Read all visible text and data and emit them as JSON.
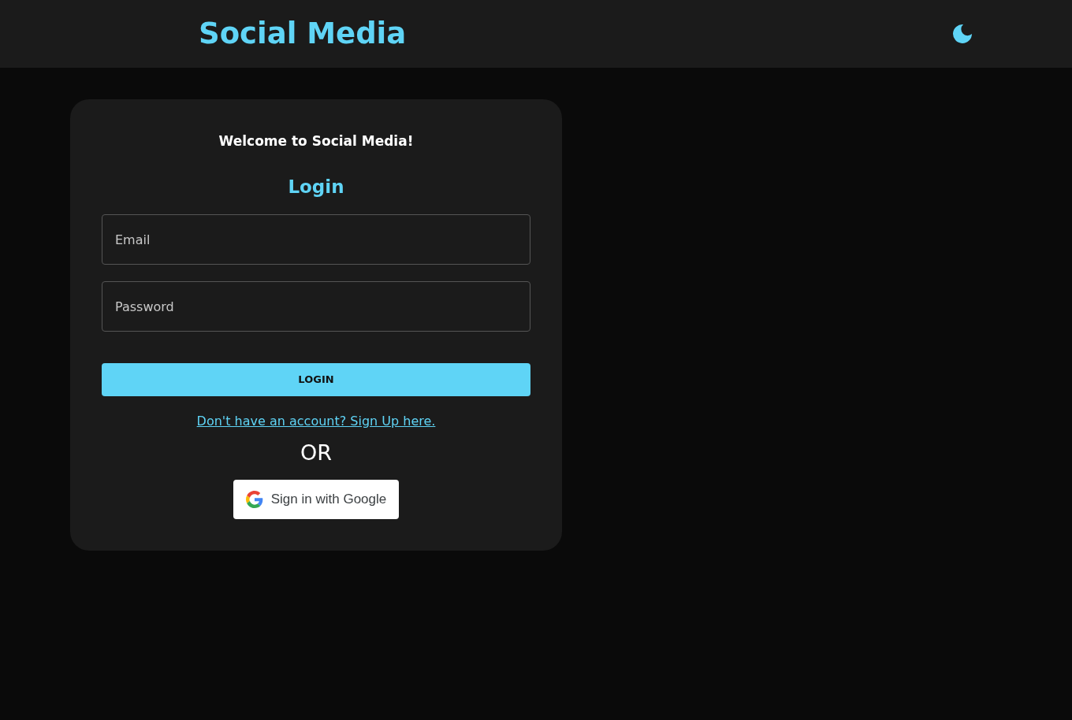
{
  "header": {
    "title": "Social Media"
  },
  "login_card": {
    "welcome": "Welcome to Social Media!",
    "heading": "Login",
    "fields": [
      {
        "placeholder": "Email"
      },
      {
        "placeholder": "Password"
      }
    ],
    "login_button": "LOGIN",
    "signup_link": "Don't have an account? Sign Up here.",
    "separator": "OR",
    "google_button": "Sign in with Google"
  }
}
